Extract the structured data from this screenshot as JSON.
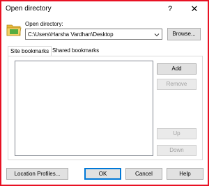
{
  "window": {
    "title": "Open directory",
    "help_glyph": "?",
    "close_glyph": "✕"
  },
  "open_directory": {
    "label": "Open directory:",
    "path_value": "C:\\Users\\Harsha Vardhan\\Desktop",
    "browse_label": "Browse...",
    "icon": "folder-icon"
  },
  "tabs": [
    {
      "label": "Site bookmarks",
      "active": true
    },
    {
      "label": "Shared bookmarks",
      "active": false
    }
  ],
  "bookmarks": {
    "items": [],
    "add_label": "Add",
    "remove_label": "Remove",
    "up_label": "Up",
    "down_label": "Down"
  },
  "footer": {
    "location_profiles_label": "Location Profiles...",
    "ok_label": "OK",
    "cancel_label": "Cancel",
    "help_label": "Help"
  },
  "colors": {
    "frame_highlight": "#e81123",
    "default_button_border": "#0078d7",
    "folder_yellow": "#f4c542"
  }
}
